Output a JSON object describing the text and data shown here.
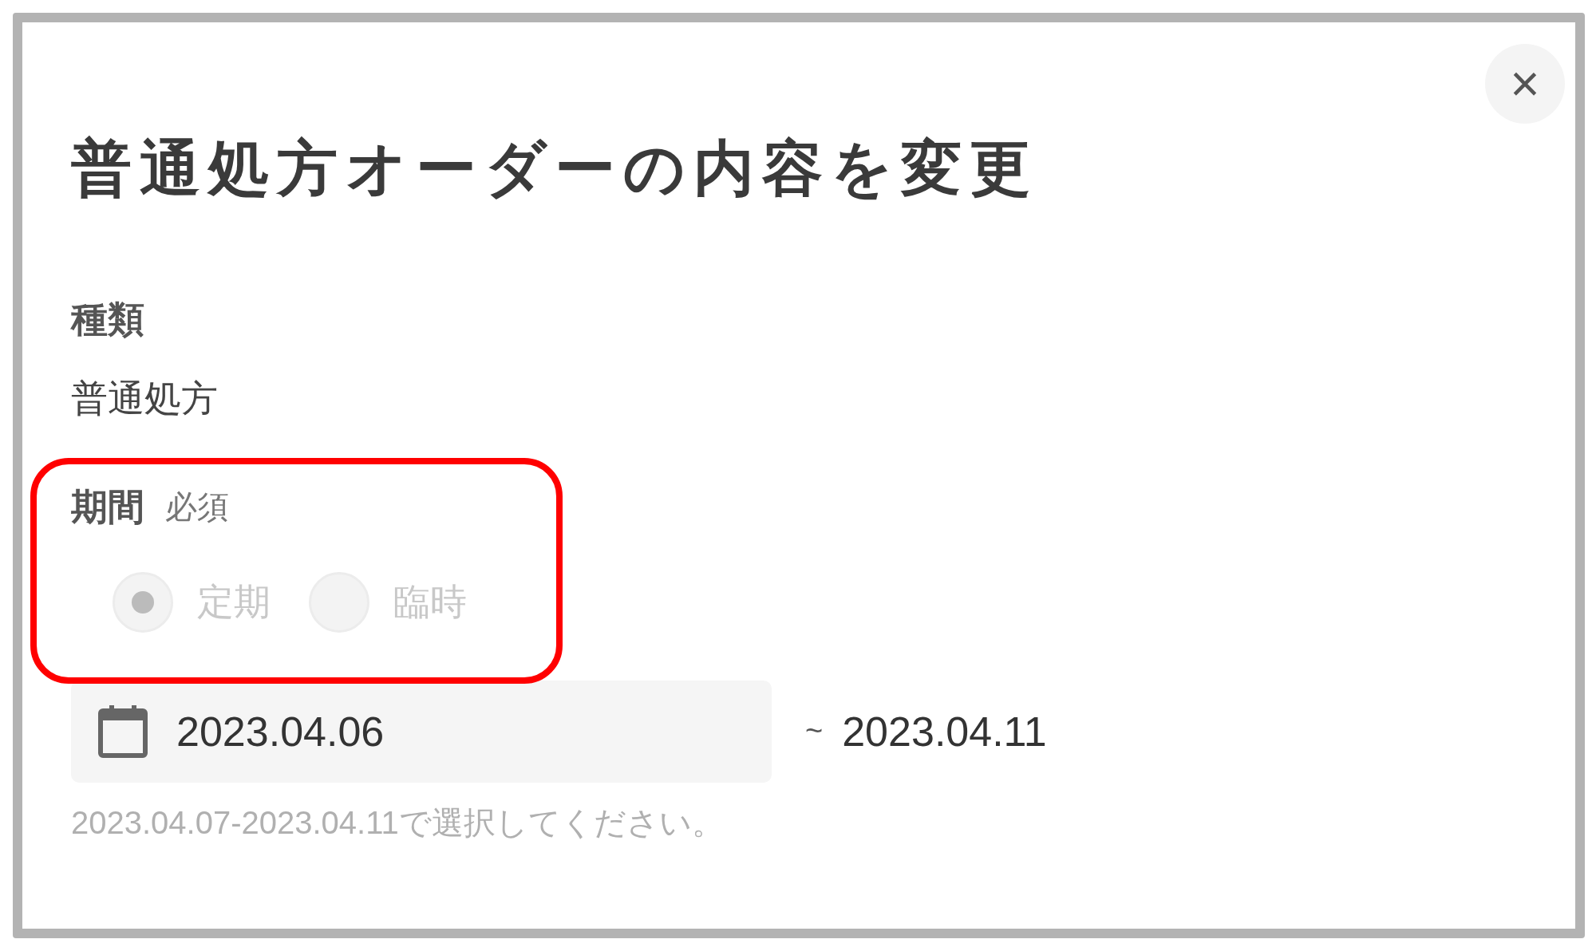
{
  "dialog": {
    "title": "普通処方オーダーの内容を変更",
    "close_button": "×"
  },
  "type_field": {
    "label": "種類",
    "value": "普通処方"
  },
  "period_field": {
    "label": "期間",
    "required_badge": "必須",
    "disabled": true,
    "options": [
      {
        "label": "定期",
        "selected": true
      },
      {
        "label": "臨時",
        "selected": false
      }
    ],
    "start_date": "2023.04.06",
    "separator": "~",
    "end_date": "2023.04.11",
    "hint": "2023.04.07-2023.04.11で選択してください。"
  },
  "annotation": {
    "color": "#ff0000"
  }
}
